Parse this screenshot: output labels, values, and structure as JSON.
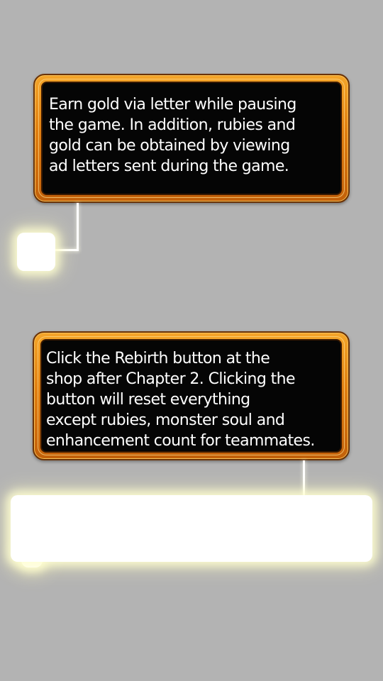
{
  "tutorial": {
    "tips": [
      {
        "text": "Earn gold via letter while pausing\nthe game. In addition, rubies and\ngold can be obtained by viewing\nad letters sent during the game."
      },
      {
        "text": "Click the Rebirth button at the\nshop after Chapter 2. Clicking the\nbutton will reset everything\nexcept rubies, monster soul and\nenhancement count for teammates."
      }
    ]
  },
  "colors": {
    "background": "#b3b3b3",
    "frame_orange": "#e07e10",
    "frame_dark": "#6b3205",
    "panel_black": "#050505",
    "text": "#ffffff",
    "highlight_glow": "#fffad2"
  }
}
